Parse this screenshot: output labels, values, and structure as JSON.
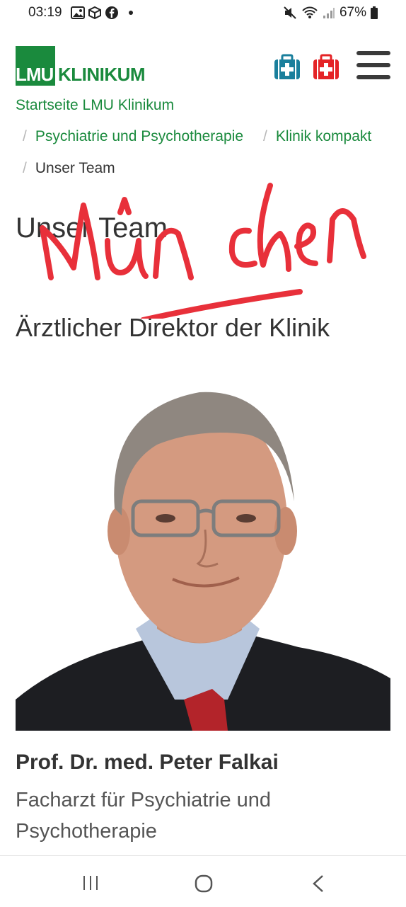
{
  "status_bar": {
    "time": "03:19",
    "battery": "67%",
    "icons": [
      "gallery-icon",
      "cube-icon",
      "facebook-icon",
      "dot",
      "mute-icon",
      "wifi-icon",
      "signal-icon",
      "battery-icon"
    ]
  },
  "header": {
    "logo_lmu": "LMU",
    "logo_klinikum": "KLINIKUM",
    "icons": [
      "medical-kit-blue-icon",
      "medical-kit-red-icon",
      "hamburger-menu-icon"
    ]
  },
  "breadcrumb": {
    "cut_item": "Startseite LMU Klinikum",
    "items": [
      "Psychiatrie und Psychotherapie",
      "Klinik kompakt",
      "Unser Team"
    ]
  },
  "page": {
    "title": "Unser Team",
    "section_heading": "Ärztlicher Direktor der Klinik"
  },
  "person": {
    "name": "Prof. Dr. med. Peter Falkai",
    "title": "Facharzt für Psychiatrie und Psychotherapie"
  },
  "annotation": {
    "handwriting": "München",
    "color": "#e8303a"
  },
  "colors": {
    "brand_green": "#1a8a3d",
    "kit_blue": "#1a7f9c",
    "kit_red": "#e42326"
  },
  "nav_bar": {
    "icons": [
      "recent-apps-icon",
      "home-icon",
      "back-icon"
    ]
  }
}
